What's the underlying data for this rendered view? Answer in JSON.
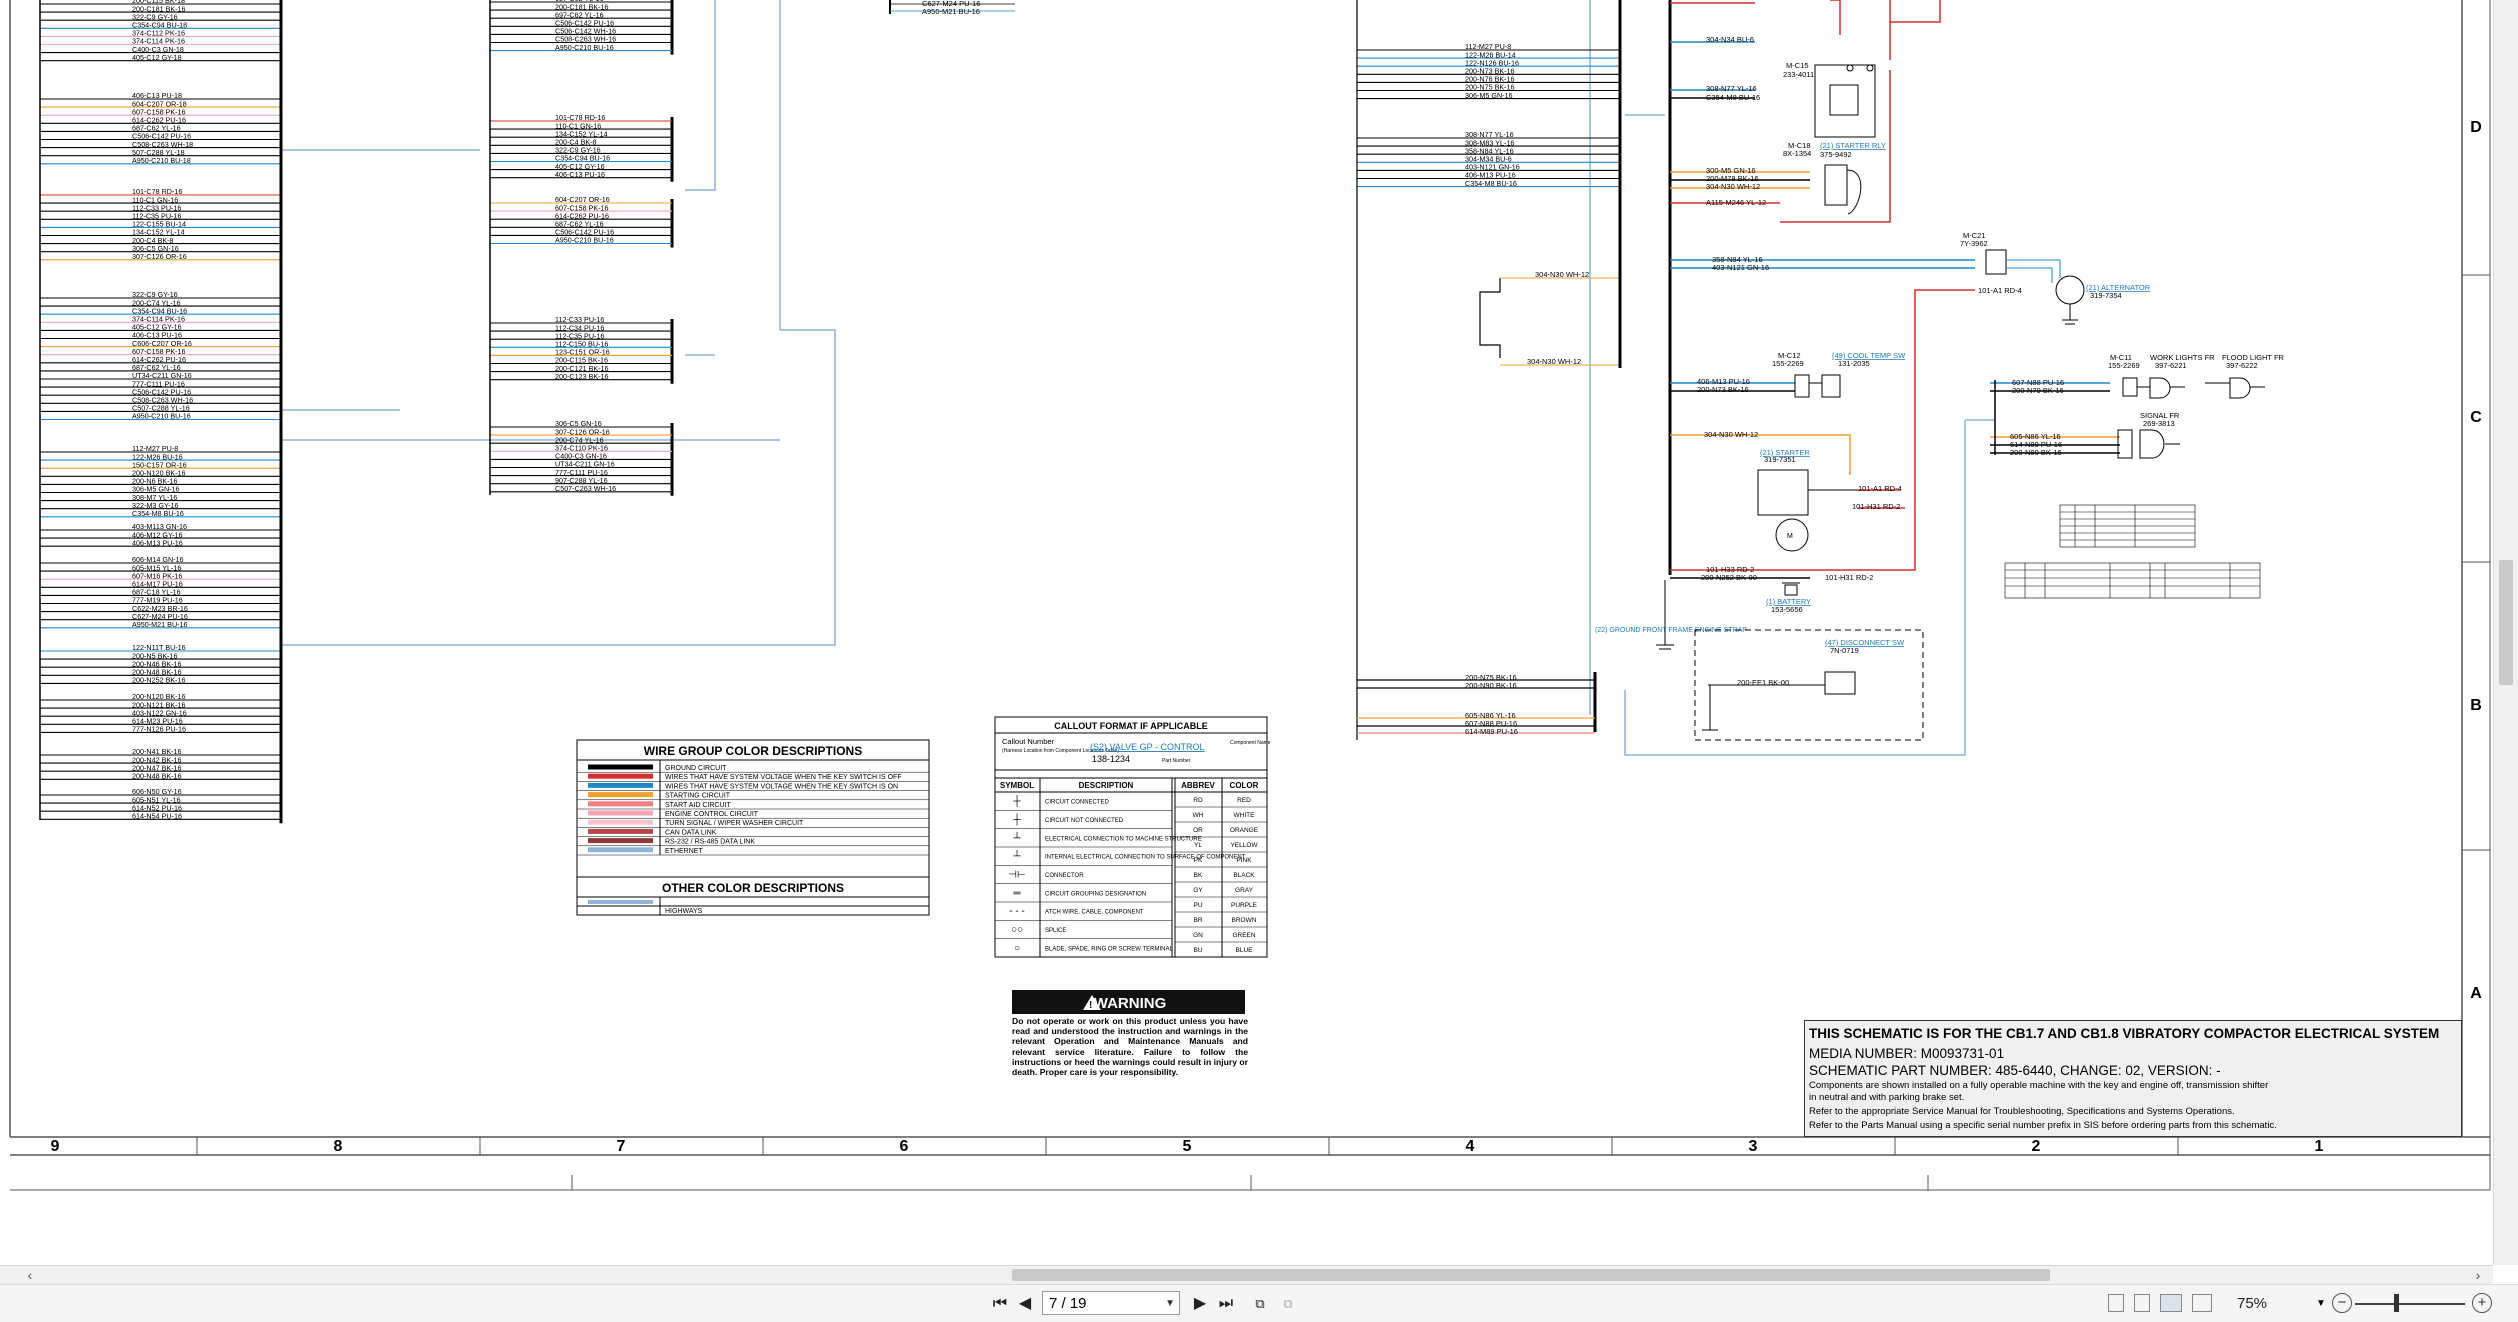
{
  "viewer": {
    "page_current": "7 / 19",
    "zoom": "75%",
    "nav": {
      "first": "⏮",
      "prev": "◀",
      "next": "▶",
      "last": "⏭"
    }
  },
  "grid": {
    "columns": [
      "9",
      "8",
      "7",
      "6",
      "5",
      "4",
      "3",
      "2",
      "1"
    ],
    "rows": [
      "D",
      "C",
      "B",
      "A"
    ]
  },
  "wire_legend": {
    "title": "WIRE GROUP COLOR DESCRIPTIONS",
    "items": [
      {
        "label": "GROUND CIRCUIT",
        "color": "#000000"
      },
      {
        "label": "WIRES THAT HAVE SYSTEM VOLTAGE WHEN THE KEY SWITCH IS OFF",
        "color": "#d32f2f"
      },
      {
        "label": "WIRES THAT HAVE SYSTEM VOLTAGE WHEN THE KEY SWITCH IS ON",
        "color": "#1e88c8"
      },
      {
        "label": "STARTING CIRCUIT",
        "color": "#f0a030"
      },
      {
        "label": "START AID CIRCUIT",
        "color": "#f08080"
      },
      {
        "label": "ENGINE CONTROL CIRCUIT",
        "color": "#f2a6b5"
      },
      {
        "label": "TURN SIGNAL / WIPER WASHER CIRCUIT",
        "color": "#f6c6d0"
      },
      {
        "label": "CAN DATA LINK",
        "color": "#b24a4a"
      },
      {
        "label": "RS-232 / RS-485 DATA LINK",
        "color": "#8d3a3a"
      },
      {
        "label": "ETHERNET",
        "color": "#8fb3d9"
      }
    ],
    "other_title": "OTHER COLOR DESCRIPTIONS",
    "other_items": [
      {
        "label": "HIGHWAYS",
        "color": "#8fb3d9"
      }
    ]
  },
  "callout": {
    "title": "CALLOUT FORMAT IF APPLICABLE",
    "callout_number": "Callout Number",
    "location_note": "(Harness Location from Component Locations Table)",
    "link": "(S2) VALVE GP - CONTROL",
    "part": "138-1234",
    "component_name": "Component Name",
    "part_number": "Part Number"
  },
  "symbols": {
    "headers": [
      "SYMBOL",
      "DESCRIPTION"
    ],
    "rows": [
      "CIRCUIT CONNECTED",
      "CIRCUIT NOT CONNECTED",
      "ELECTRICAL CONNECTION TO MACHINE STRUCTURE",
      "INTERNAL ELECTRICAL CONNECTION TO SURFACE OF COMPONENT",
      "CONNECTOR",
      "CIRCUIT GROUPING DESIGNATION",
      "ATCH WIRE, CABLE, COMPONENT",
      "SPLICE",
      "BLADE, SPADE, RING OR SCREW TERMINAL"
    ]
  },
  "colors_table": {
    "headers": [
      "ABBREV",
      "COLOR"
    ],
    "rows": [
      [
        "RD",
        "RED"
      ],
      [
        "WH",
        "WHITE"
      ],
      [
        "OR",
        "ORANGE"
      ],
      [
        "YL",
        "YELLOW"
      ],
      [
        "PK",
        "PINK"
      ],
      [
        "BK",
        "BLACK"
      ],
      [
        "GY",
        "GRAY"
      ],
      [
        "PU",
        "PURPLE"
      ],
      [
        "BR",
        "BROWN"
      ],
      [
        "GN",
        "GREEN"
      ],
      [
        "BU",
        "BLUE"
      ]
    ]
  },
  "warning": {
    "title": "WARNING",
    "text": "Do not operate or work on this product unless you have read and understood the instruction and warnings in the relevant Operation and Maintenance Manuals and relevant service literature. Failure to follow the instructions or heed the warnings could result in injury or death. Proper care is your responsibility."
  },
  "title_block": {
    "title": "THIS SCHEMATIC IS FOR THE CB1.7 AND CB1.8 VIBRATORY COMPACTOR ELECTRICAL SYSTEM",
    "media": "MEDIA NUMBER: M0093731-01",
    "part": "SCHEMATIC PART NUMBER: 485-6440, CHANGE: 02, VERSION: -",
    "note1": "Components are shown installed on a fully operable machine with the key and engine off, transmission shifter",
    "note2": "in neutral and with parking brake set.",
    "note3": "Refer to the appropriate Service Manual for Troubleshooting, Specifications and Systems Operations.",
    "note4": "Refer to the Parts Manual using a specific serial number prefix in SIS before ordering parts from this schematic."
  },
  "components": {
    "starter_rly": "(21) STARTER RLY",
    "starter_rly_pn": "375-9492",
    "alternator": "(21) ALTERNATOR",
    "alternator_pn": "319-7354",
    "coolant_temp": "(49) COOL TEMP SW",
    "coolant_temp_pn": "131-2035",
    "starter": "(21) STARTER",
    "starter_pn": "319-7351",
    "battery": "(1) BATTERY",
    "battery_pn": "153-5656",
    "disconnect": "(47) DISCONNECT SW",
    "disconnect_pn": "7N-0719",
    "ground_strap": "(22) GROUND FRONT FRAME ENGINE STRAP",
    "work_lights": "WORK LIGHTS FR",
    "work_lights_pn": "397-6221",
    "flood_light": "FLOOD LIGHT FR",
    "flood_light_pn": "397-6222",
    "signal_fr": "SIGNAL FR",
    "signal_fr_pn": "269-3813"
  },
  "wires": {
    "w101_a1": "101-A1 RD-4",
    "w101_h31": "101-H31 RD-2",
    "w101_h33": "101-H33 RD-2",
    "w200_n252": "200-N252 BK-00",
    "w200_ee1": "200-EE1 BK-00",
    "w304_n30": "304-N30 WH-12",
    "w358_n84": "358-N84 YL-16",
    "w403_n121": "403-N121 GN-16",
    "w308_n77": "308-N77 YL-16",
    "w354_m8": "C354-M8 BU-16",
    "w607_n88": "607-N88 PU-16",
    "w200_n79": "200-N79 BK-16",
    "w605_n86": "605-N86 YL-16",
    "w614_n89": "614-N89 PU-16",
    "w200_n80": "200-N80 BK-16",
    "w406_m13": "406-M13 PU-16",
    "w200_n73": "200-N73 BK-16",
    "w304_n34": "304-N34 BU-6",
    "w200_n75": "200-N75 BK-16",
    "w200_n90": "200-N90 BK-16",
    "w605_n86b": "605-N86 YL-16",
    "w607_n88b": "607-N88 PU-16",
    "w614_m89": "614-M89 PU-16",
    "w115_m246": "A115-M246 YL-12",
    "w300_m5": "300-M5 GN-16",
    "w200_m78": "200-M78 BK-16",
    "w304_n30b": "304-N30 WH-12"
  },
  "connectors": {
    "c15": "M-C15",
    "c15_pn": "233-4011",
    "c18": "M-C18",
    "c18_pn": "8X-1354",
    "c21": "M-C21",
    "c21_pn": "7Y-3962",
    "c12": "M-C12",
    "c12_pn": "155-2269",
    "c11": "M-C11",
    "c11_pn": "155-2269"
  },
  "harness_left": {
    "group1": [
      "200-C115 BK-18",
      "200-C181 BK-16",
      "322-C9 GY-16",
      "C354-C94 BU-18",
      "374-C112 PK-16",
      "374-C114 PK-16",
      "C400-C3 GN-18",
      "405-C12 GY-18"
    ],
    "group2": [
      "406-C13 PU-18",
      "604-C207 OR-18",
      "607-C158 PK-16",
      "614-C262 PU-16",
      "687-C62 YL-16",
      "C506-C142 PU-16",
      "C508-C263 WH-18",
      "507-C288 YL-18",
      "A950-C210 BU-18"
    ],
    "group3": [
      "101-C78 RD-16",
      "110-C1 GN-16",
      "112-C33 PU-16",
      "112-C35 PU-16",
      "122-C155 BU-14",
      "134-C152 YL-14",
      "200-C4 BK-8",
      "306-C5 GN-16",
      "307-C126 OR-16"
    ],
    "group4": [
      "322-C9 GY-16",
      "200-C74 YL-16",
      "C354-C94 BU-16",
      "374-C114 PK-16",
      "405-C12 GY-16",
      "406-C13 PU-16",
      "C606-C207 OR-16",
      "607-C158 PK-16",
      "614-C262 PU-16",
      "687-C62 YL-16",
      "UT34-C211 GN-16",
      "777-C111 PU-16",
      "C506-C142 PU-16",
      "C508-C263 WH-16",
      "C507-C288 YL-16",
      "A950-C210 BU-16"
    ],
    "group5": [
      "112-M27 PU-8",
      "122-M26 BU-16",
      "150-C157 OR-16",
      "200-N120 BK-16",
      "200-N6 BK-16",
      "306-M5 GN-16",
      "308-M7 YL-16",
      "322-M3 GY-16",
      "C354-M8 BU-16"
    ],
    "group6": [
      "403-M113 GN-16",
      "406-M12 GY-16",
      "406-M13 PU-16"
    ],
    "group7": [
      "606-M14 GN-16",
      "605-M15 YL-16",
      "607-M16 PK-16",
      "614-M17 PU-16",
      "687-C18 YL-16",
      "777-M19 PU-16",
      "C622-M23 BR-16",
      "C627-M24 PU-16",
      "A950-M21 BU-16"
    ],
    "group8": [
      "122-N11T BU-16",
      "200-N5 BK-16",
      "200-N46 BK-16",
      "200-N48 BK-16",
      "200-N252 BK-16"
    ],
    "group9": [
      "200-N120 BK-16",
      "200-N121 BK-16",
      "403-N122 GN-16",
      "614-M23 PU-16",
      "777-N126 PU-16"
    ],
    "group10": [
      "200-N41 BK-16",
      "200-N42 BK-16",
      "200-N47 BK-16",
      "200-N48 BK-16"
    ],
    "group11": [
      "606-N50 GY-16",
      "605-N51 YL-16",
      "614-N52 PU-16",
      "614-N54 PU-16"
    ]
  },
  "harness_mid": {
    "group1": [
      "687-C62 YL-16",
      "200-C181 BK-16",
      "697-C62 YL-16",
      "C506-C142 PU-16",
      "C506-C142 WH-16",
      "C508-C263 WH-16",
      "A950-C210 BU-16"
    ],
    "group2": [
      "101-C78 RD-16",
      "110-C1 GN-16",
      "134-C152 YL-14",
      "200-C4 BK-8",
      "322-C9 GY-16",
      "C354-C94 BU-16",
      "405-C12 GY-16",
      "406-C13 PU-16"
    ],
    "group3": [
      "604-C207 OR-16",
      "607-C158 PK-16",
      "614-C262 PU-16",
      "687-C62 YL-16",
      "C506-C142 PU-16",
      "A950-C210 BU-16"
    ],
    "group4": [
      "112-C33 PU-16",
      "112-C34 PU-16",
      "112-C35 PU-16",
      "112-C150 BU-16",
      "123-C151 OR-16",
      "200-C115 BK-16",
      "200-C121 BK-16",
      "200-C123 BK-16"
    ],
    "group5": [
      "306-C5 GN-16",
      "307-C126 OR-16",
      "200-C74 YL-16",
      "374-C110 PK-16",
      "C400-C3 GN-16",
      "UT34-C211 GN-16",
      "777-C111 PU-16",
      "907-C288 YL-16",
      "C507-C263 WH-16"
    ],
    "top_small": [
      "C627-M24 PU-16",
      "A950-M21 BU-16"
    ]
  },
  "harness_right": {
    "group1": [
      "112-M27 PU-8",
      "122-M26 BU-14",
      "122-N126 BU-16",
      "200-N73 BK-16",
      "200-N76 BK-16",
      "200-N75 BK-16",
      "306-M5 GN-16"
    ],
    "group2": [
      "308-N77 YL-16",
      "308-M83 YL-16",
      "358-N84 YL-16",
      "304-M34 BU-6",
      "403-N121 GN-16",
      "406-M13 PU-16",
      "C354-M8 BU-16"
    ],
    "loop1": "304-N30 WH-12",
    "loop2": "304-N30 WH-12",
    "top": "122-M26 BU-16"
  }
}
